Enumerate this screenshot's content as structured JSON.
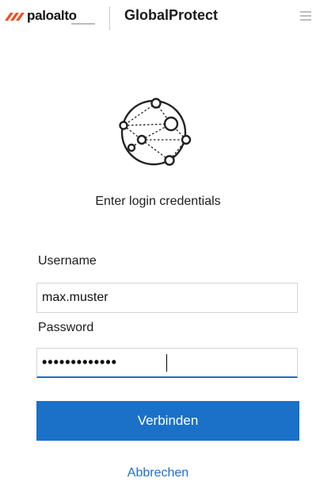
{
  "header": {
    "brand": "paloalto",
    "product": "GlobalProtect",
    "menu_icon": "hamburger-menu-icon"
  },
  "main": {
    "illustration_icon": "network-globe-icon",
    "prompt": "Enter login credentials",
    "username_label": "Username",
    "username_value": "max.muster",
    "password_label": "Password",
    "password_value": "•••••••••••••",
    "connect_label": "Verbinden",
    "cancel_label": "Abbrechen"
  },
  "colors": {
    "accent": "#1b70c7",
    "brand_orange": "#f04e23"
  }
}
